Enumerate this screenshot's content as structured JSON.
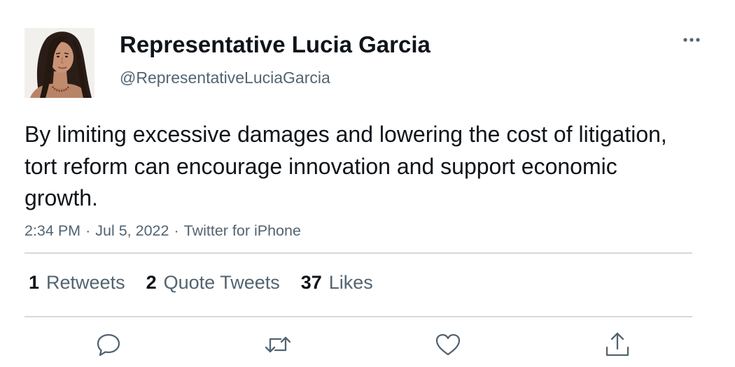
{
  "tweet": {
    "author": {
      "display_name": "Representative Lucia Garcia",
      "handle": "@RepresentativeLuciaGarcia",
      "avatar_icon": "avatar-photo"
    },
    "text": "By limiting excessive damages and lowering the cost of litigation, tort reform can encourage innovation and support economic growth.",
    "time": "2:34 PM",
    "date": "Jul 5, 2022",
    "source": "Twitter for iPhone",
    "separator": "·",
    "stats": {
      "retweets_count": "1",
      "retweets_label": "Retweets",
      "quote_count": "2",
      "quote_label": "Quote Tweets",
      "likes_count": "37",
      "likes_label": "Likes"
    },
    "actions": [
      {
        "icon": "reply-icon"
      },
      {
        "icon": "retweet-icon"
      },
      {
        "icon": "like-icon"
      },
      {
        "icon": "share-icon"
      }
    ],
    "more_icon": "more-options-icon"
  },
  "colors": {
    "text_primary": "#0f1419",
    "text_secondary": "#536471",
    "divider": "#d9d9d9"
  }
}
